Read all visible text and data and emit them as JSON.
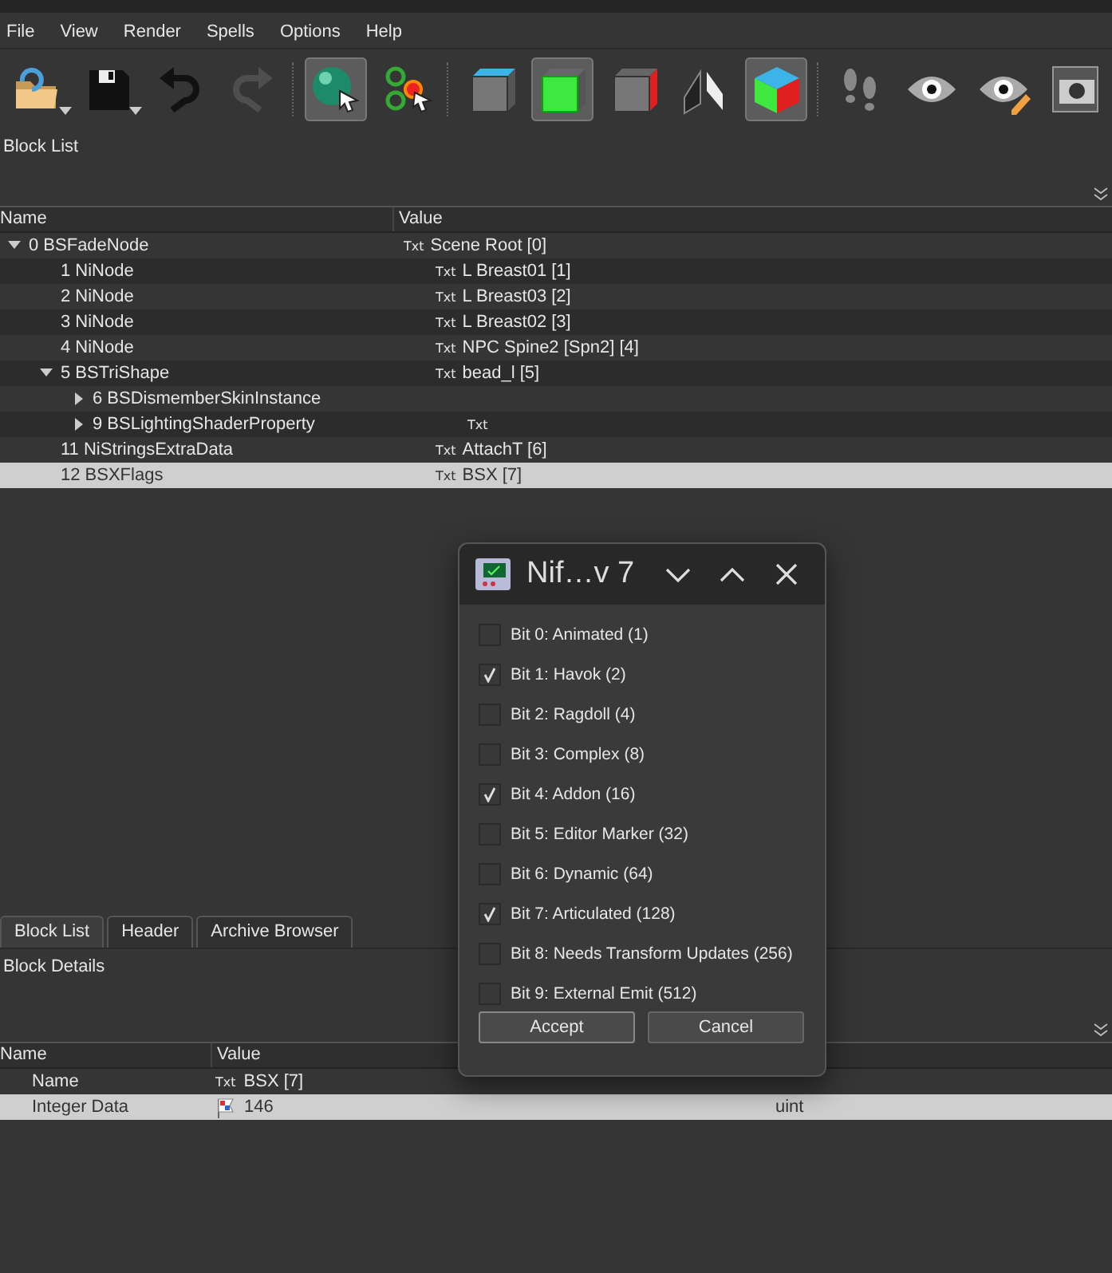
{
  "menu": [
    "File",
    "View",
    "Render",
    "Spells",
    "Options",
    "Help"
  ],
  "toolbar": [
    {
      "kind": "open",
      "menu": true,
      "pressed": false
    },
    {
      "kind": "save",
      "menu": true,
      "pressed": false
    },
    {
      "kind": "undo",
      "pressed": false,
      "disabled": false
    },
    {
      "kind": "redo",
      "pressed": false,
      "disabled": true
    },
    {
      "kind": "sep"
    },
    {
      "kind": "select-object",
      "pressed": true
    },
    {
      "kind": "select-vertex",
      "pressed": false
    },
    {
      "kind": "sep"
    },
    {
      "kind": "cube-top",
      "pressed": false
    },
    {
      "kind": "cube-front",
      "pressed": true
    },
    {
      "kind": "cube-side",
      "pressed": false
    },
    {
      "kind": "flip",
      "pressed": false
    },
    {
      "kind": "cube-rgb",
      "pressed": true
    },
    {
      "kind": "sep"
    },
    {
      "kind": "footprints",
      "pressed": false
    },
    {
      "kind": "eye",
      "pressed": false
    },
    {
      "kind": "eye-edit",
      "pressed": false
    },
    {
      "kind": "camera",
      "pressed": false
    }
  ],
  "block_list": {
    "title": "Block List",
    "columns": [
      "Name",
      "Value"
    ],
    "rows": [
      {
        "name": "0 BSFadeNode",
        "badge": "Txt",
        "value": "Scene Root [0]",
        "expanded": true,
        "selected": false,
        "children": [
          {
            "name": "1 NiNode",
            "badge": "Txt",
            "value": "L Breast01 [1]",
            "selected": false
          },
          {
            "name": "2 NiNode",
            "badge": "Txt",
            "value": "L Breast03 [2]",
            "selected": false
          },
          {
            "name": "3 NiNode",
            "badge": "Txt",
            "value": "L Breast02 [3]",
            "selected": false
          },
          {
            "name": "4 NiNode",
            "badge": "Txt",
            "value": "NPC Spine2 [Spn2] [4]",
            "selected": false
          },
          {
            "name": "5 BSTriShape",
            "badge": "Txt",
            "value": "bead_l [5]",
            "expanded": true,
            "selected": false,
            "children": [
              {
                "name": "6 BSDismemberSkinInstance",
                "expanded": false,
                "selected": false
              },
              {
                "name": "9 BSLightingShaderProperty",
                "badge": "Txt",
                "expanded": false,
                "selected": false
              }
            ]
          },
          {
            "name": "11 NiStringsExtraData",
            "badge": "Txt",
            "value": "AttachT [6]",
            "selected": false
          },
          {
            "name": "12 BSXFlags",
            "badge": "Txt",
            "value": "BSX [7]",
            "selected": true
          }
        ]
      }
    ]
  },
  "tabs": [
    {
      "label": "Block List",
      "selected": true
    },
    {
      "label": "Header",
      "selected": false
    },
    {
      "label": "Archive Browser",
      "selected": false
    }
  ],
  "block_details": {
    "title": "Block Details",
    "columns": [
      "Name",
      "Value"
    ],
    "rows": [
      {
        "name": "Name",
        "kind": "text",
        "badge": "Txt",
        "value": "BSX [7]",
        "selected": false
      },
      {
        "name": "Integer Data",
        "kind": "flag",
        "value": "146",
        "column_3": "uint",
        "selected": true
      }
    ]
  },
  "dialog": {
    "title": "Nif…v 7",
    "flags": [
      {
        "label": "Bit 0: Animated (1)",
        "checked": false
      },
      {
        "label": "Bit 1: Havok (2)",
        "checked": true
      },
      {
        "label": "Bit 2: Ragdoll (4)",
        "checked": false
      },
      {
        "label": "Bit 3: Complex (8)",
        "checked": false
      },
      {
        "label": "Bit 4: Addon (16)",
        "checked": true
      },
      {
        "label": "Bit 5: Editor Marker (32)",
        "checked": false
      },
      {
        "label": "Bit 6: Dynamic (64)",
        "checked": false
      },
      {
        "label": "Bit 7: Articulated (128)",
        "checked": true
      },
      {
        "label": "Bit 8: Needs Transform Updates (256)",
        "checked": false
      },
      {
        "label": "Bit 9: External Emit (512)",
        "checked": false
      }
    ],
    "buttons": [
      "Accept",
      "Cancel"
    ]
  }
}
